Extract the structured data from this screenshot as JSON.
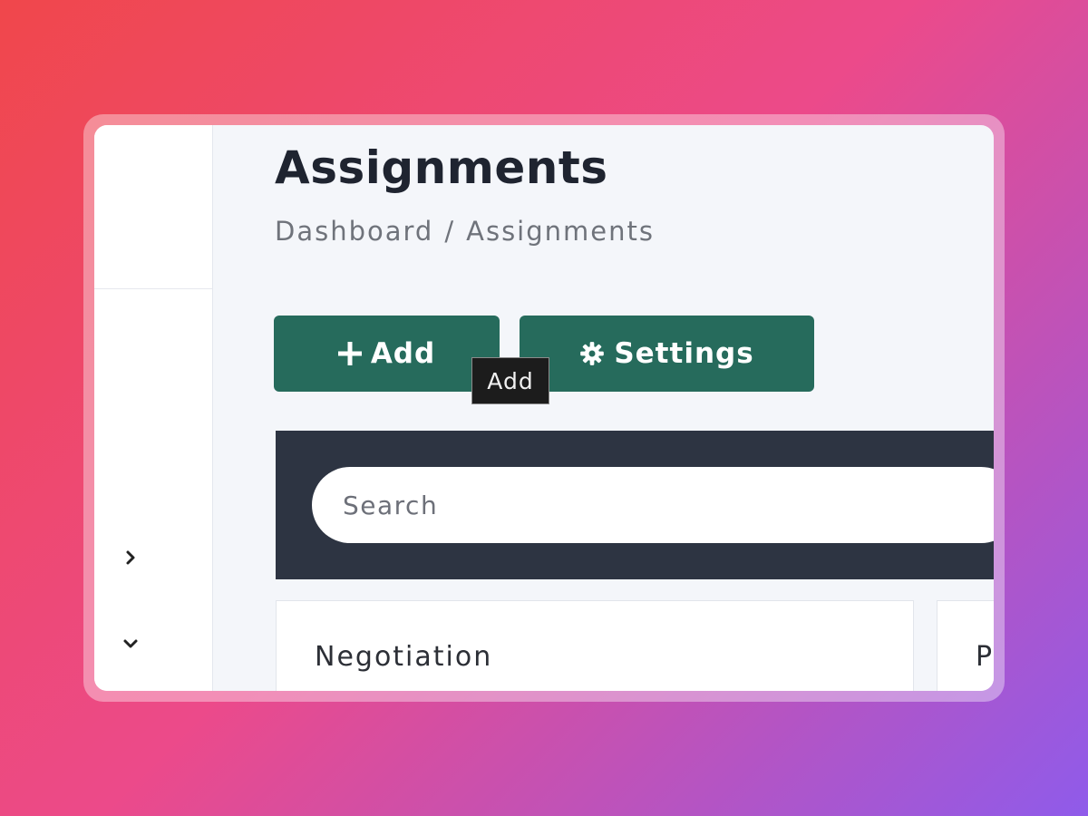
{
  "page": {
    "title": "Assignments"
  },
  "breadcrumb": {
    "home": "Dashboard",
    "separator": "/",
    "current": "Assignments"
  },
  "toolbar": {
    "add_label": "Add",
    "add_icon": "plus-icon",
    "settings_label": "Settings",
    "settings_icon": "gear-icon",
    "tooltip": "Add"
  },
  "search": {
    "placeholder": "Search"
  },
  "cards": [
    {
      "title": "Negotiation"
    },
    {
      "title": "P"
    }
  ],
  "sidebar": {
    "icons": [
      "chevron-right-icon",
      "chevron-down-icon"
    ]
  },
  "colors": {
    "accent": "#266b5c",
    "toolbar_bg": "#2d3442",
    "page_bg": "#f4f6fa"
  }
}
